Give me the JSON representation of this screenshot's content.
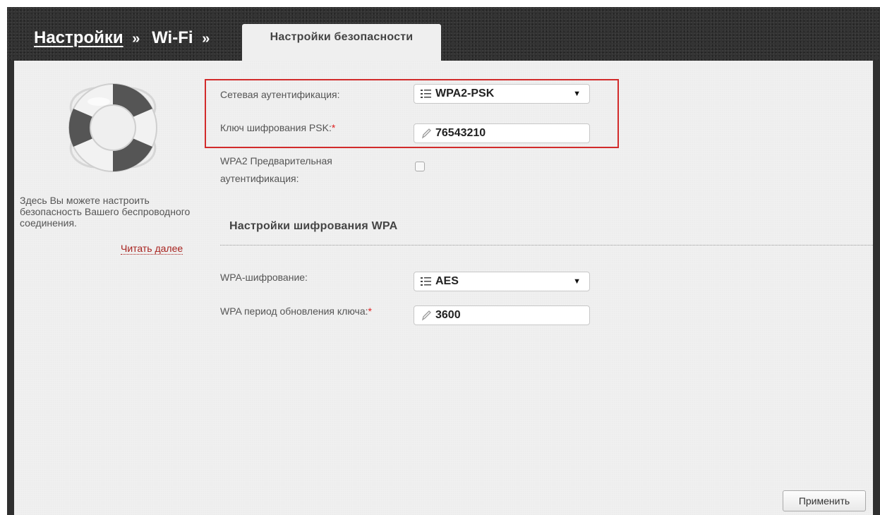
{
  "header": {
    "crumb_settings": "Настройки",
    "crumb_wifi": "Wi-Fi",
    "separator": "»",
    "active_tab": "Настройки безопасности"
  },
  "sidebar": {
    "icon": "lifebuoy-icon",
    "description": "Здесь Вы можете настроить безопасность Вашего беспроводного соединения.",
    "read_more": "Читать далее"
  },
  "form": {
    "auth_label": "Сетевая аутентификация:",
    "auth_value": "WPA2-PSK",
    "psk_label": "Ключ шифрования PSK:",
    "psk_value": "76543210",
    "required_mark": "*",
    "preauth_label_line1": "WPA2 Предварительная",
    "preauth_label_line2": "аутентификация:",
    "preauth_checked": false
  },
  "wpa_section": {
    "title": "Настройки шифрования WPA",
    "encryption_label": "WPA-шифрование:",
    "encryption_value": "AES",
    "rekey_label": "WPA период обновления ключа:",
    "rekey_value": "3600"
  },
  "apply_button": "Применить",
  "colors": {
    "header_bg": "#323232",
    "content_bg": "#f0f0f0",
    "highlight": "#d22b2b",
    "link": "#a8231f",
    "required": "#e02020"
  }
}
